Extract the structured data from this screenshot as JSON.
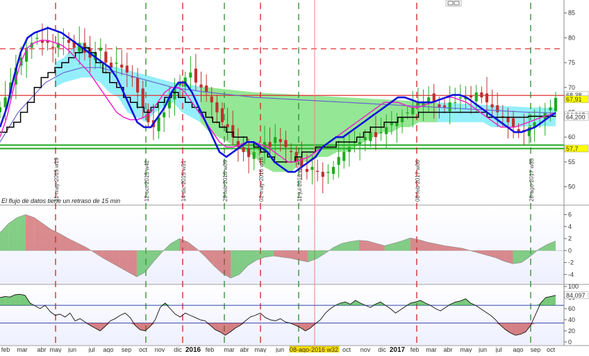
{
  "chart_data": [
    {
      "type": "candlestick",
      "panel": "price",
      "yticks": [
        50,
        55,
        60,
        65,
        70,
        75,
        80,
        85
      ],
      "ylim": [
        47,
        86.5
      ],
      "note": "El flujo de datos tiene un retraso de 15 min",
      "vertical_labels": [
        "11-may-2015 w19",
        "12-oct-2015 w42",
        "14-dic-2015 w51",
        "29-feb-2016 w09",
        "02-may-2016 w18",
        "11-jul-2016 w28",
        "08-feb-2017 w06",
        "28-ago-2017 w35"
      ],
      "price_tags": [
        {
          "text": "68,38",
          "value": 68.38,
          "color": "#ffffff"
        },
        {
          "text": "67,91",
          "value": 67.91,
          "color": "#ffff00"
        },
        {
          "text": "64,915",
          "value": 64.915,
          "color": "#ffffff"
        },
        {
          "text": "64,200",
          "value": 64.2,
          "color": "#ffffff"
        },
        {
          "text": "57,7",
          "value": 57.7,
          "color": "#ffff00"
        }
      ],
      "horizontal_lines": [
        {
          "value": 77.8,
          "style": "dashed",
          "color": "#e03030"
        },
        {
          "value": 68.4,
          "style": "solid",
          "color": "#e03030"
        },
        {
          "value": 58.4,
          "style": "solid",
          "color": "#22aa22"
        },
        {
          "value": 57.7,
          "style": "solid",
          "color": "#22aa22"
        }
      ],
      "close": [
        66,
        68,
        71,
        74,
        76,
        78,
        79,
        80,
        79,
        79,
        78,
        79,
        80,
        79,
        78,
        79,
        77,
        76,
        77,
        78,
        75,
        74,
        75,
        74,
        73,
        72,
        69,
        66,
        63,
        62,
        64,
        65,
        68,
        70,
        71,
        72,
        73,
        71,
        70,
        69,
        67,
        65,
        63,
        62,
        60,
        58,
        57,
        56,
        57,
        58,
        59,
        58,
        60,
        59,
        58,
        57,
        55,
        54,
        53,
        54,
        53,
        52,
        53,
        54,
        56,
        57,
        58,
        59,
        59,
        60,
        61,
        60,
        61,
        62,
        63,
        63,
        64,
        65,
        66,
        67,
        67,
        68,
        67,
        66,
        66,
        67,
        67,
        68,
        68,
        68,
        69,
        68,
        67,
        66,
        65,
        64,
        63,
        62,
        61,
        61,
        62,
        63,
        64,
        65,
        66,
        67.91
      ],
      "ma_blue": [
        62,
        66,
        72,
        77,
        80,
        81,
        81.5,
        82,
        81.5,
        81,
        80,
        79,
        78,
        77,
        76,
        75,
        74,
        72,
        69,
        66,
        63,
        62,
        62,
        64,
        66,
        69,
        71,
        71,
        69,
        66,
        63,
        60,
        57,
        56,
        57,
        58,
        59,
        59,
        58,
        57,
        55,
        54,
        53,
        53,
        54,
        55,
        56,
        58,
        59,
        60,
        60,
        61,
        62,
        63,
        64,
        65,
        66,
        67,
        68,
        68,
        67.5,
        67,
        67,
        67,
        67.5,
        68,
        68.5,
        68.5,
        68,
        67,
        66,
        65,
        64,
        63,
        62,
        61,
        61,
        61.5,
        62,
        63,
        64,
        64.9
      ],
      "ma_magenta": [
        60,
        64,
        70,
        75,
        78,
        79,
        79.5,
        79.5,
        79,
        78.5,
        77.5,
        76,
        74.5,
        73,
        71,
        69,
        67,
        65,
        64,
        63.5,
        63.5,
        64,
        65,
        67,
        69,
        70,
        70,
        69,
        67,
        65,
        63,
        61,
        59,
        58,
        58,
        58.5,
        59,
        59,
        58.5,
        58,
        57,
        56,
        55,
        55,
        55.5,
        56,
        57,
        58,
        59,
        60,
        61,
        62,
        63,
        64,
        65,
        66,
        67,
        67,
        67,
        66.5,
        66,
        66,
        66.5,
        67,
        67.5,
        68,
        68,
        67.5,
        67,
        66,
        65,
        64,
        63,
        62,
        62,
        62,
        62.5,
        63,
        63.5,
        64,
        64.5,
        64.9
      ],
      "ma_black": [
        61,
        62,
        63,
        65,
        67,
        70,
        72,
        73,
        74,
        75,
        76,
        77,
        78,
        77,
        75,
        73,
        71,
        70,
        68,
        67,
        66,
        65,
        66,
        67,
        68,
        69,
        68,
        67,
        66,
        65,
        64,
        63,
        62,
        61,
        60,
        60,
        59,
        58,
        57,
        56,
        55,
        55,
        55,
        56,
        57,
        57,
        58,
        58,
        58,
        59,
        59,
        59,
        60,
        61,
        62,
        62,
        63,
        63,
        64,
        64,
        64,
        65,
        65,
        65,
        65,
        65,
        65,
        65,
        65,
        65,
        65,
        64,
        64,
        64,
        64,
        64,
        64,
        64.2,
        64.2,
        64.2,
        64.2,
        64.2
      ],
      "ma_purple": [
        59,
        62,
        65,
        67,
        69,
        71,
        72,
        73,
        73.5,
        74,
        74,
        74,
        73.5,
        73,
        72.5,
        72,
        71.5,
        71,
        70.5,
        70,
        69.7,
        69.5,
        69.2,
        69,
        68.8,
        68.6,
        68.4,
        68.2,
        68,
        67.9,
        67.8,
        67.7,
        67.6,
        67.5,
        67.4,
        67.3,
        67.2,
        67.1,
        67,
        66.9,
        66.8,
        66.7,
        66.6,
        66.5,
        66.4,
        66.3,
        66.2,
        66.1,
        66,
        65.9,
        65.8,
        65.7,
        65.6,
        65.5,
        65.4,
        65.3,
        65.2,
        65.1,
        65,
        65,
        64.9,
        64.9
      ]
    },
    {
      "type": "area",
      "panel": "oscillator-1",
      "yticks": [
        -4,
        -2,
        0,
        2,
        4,
        6
      ],
      "ylim": [
        -5.3,
        7
      ],
      "values": [
        3,
        4.5,
        5.5,
        6,
        5.5,
        4.5,
        3.5,
        2.8,
        2,
        1.3,
        0.6,
        -0.3,
        -1.2,
        -2,
        -2.8,
        -3.6,
        -4.4,
        -3.6,
        -1.8,
        -0.2,
        1.2,
        2,
        1.4,
        0.3,
        -1,
        -2.5,
        -3.8,
        -4.6,
        -4,
        -2.5,
        -1.6,
        -1.1,
        -0.9,
        -1.1,
        -1.3,
        -1.6,
        -1.9,
        -1.4,
        -0.5,
        0.5,
        1.2,
        1.5,
        1.7,
        1.6,
        1.2,
        0.8,
        1.2,
        1.6,
        2.1,
        1.8,
        1.4,
        1.1,
        0.8,
        0.6,
        0.4,
        0,
        -0.4,
        -0.8,
        -1.2,
        -1.8,
        -2.2,
        -2,
        -1,
        0.2,
        1,
        1.6
      ]
    },
    {
      "type": "line",
      "panel": "oscillator-2",
      "yticks": [
        0,
        20,
        40,
        60,
        80,
        100
      ],
      "ylim": [
        -4,
        100
      ],
      "levels": [
        66,
        34
      ],
      "last_value_text": "84,097",
      "last_value": 84.097,
      "values": [
        80,
        82,
        81,
        85,
        86,
        84,
        70,
        65,
        60,
        66,
        55,
        48,
        50,
        45,
        52,
        38,
        42,
        36,
        30,
        25,
        20,
        28,
        38,
        42,
        48,
        52,
        44,
        30,
        22,
        20,
        28,
        40,
        62,
        70,
        60,
        50,
        45,
        52,
        48,
        44,
        40,
        38,
        30,
        22,
        18,
        12,
        18,
        25,
        30,
        38,
        45,
        48,
        52,
        44,
        40,
        38,
        42,
        36,
        34,
        30,
        26,
        20,
        25,
        33,
        40,
        52,
        60,
        66,
        70,
        72,
        68,
        75,
        70,
        66,
        62,
        68,
        72,
        66,
        60,
        52,
        58,
        64,
        70,
        72,
        75,
        70,
        66,
        60,
        56,
        62,
        68,
        72,
        74,
        78,
        70,
        66,
        60,
        54,
        48,
        40,
        30,
        22,
        16,
        12,
        14,
        18,
        30,
        50,
        70,
        80,
        82,
        84
      ]
    }
  ],
  "x_axis": {
    "labels": [
      "feb",
      "mar",
      "abr",
      "may",
      "jun",
      "jul",
      "ago",
      "sep",
      "oct",
      "nov",
      "dic",
      "2016",
      "feb",
      "mar",
      "abr",
      "may",
      "jun",
      "08-ago-2016 w32",
      "oct",
      "nov",
      "dic",
      "2017",
      "feb",
      "mar",
      "abr",
      "may",
      "jun",
      "jul",
      "ago",
      "sep",
      "oct"
    ],
    "bold": [
      "2016",
      "2017"
    ],
    "highlighted": "08-ago-2016 w32"
  },
  "colors": {
    "bull": "#22aa22",
    "bear": "#c03030",
    "ma_blue": "#1010dd",
    "ma_magenta": "#ee22cc",
    "ma_black": "#000000",
    "ma_purple": "#6666cc",
    "cloud_cyan": "#66e8f8",
    "cloud_green": "#66dd66",
    "hline_red": "#e03030",
    "hline_green": "#22aa22",
    "vline_green": "#2a8a2a",
    "vline_red": "#d02020",
    "cursor": "#f08080",
    "panel_bg": "#f6f6ff"
  }
}
